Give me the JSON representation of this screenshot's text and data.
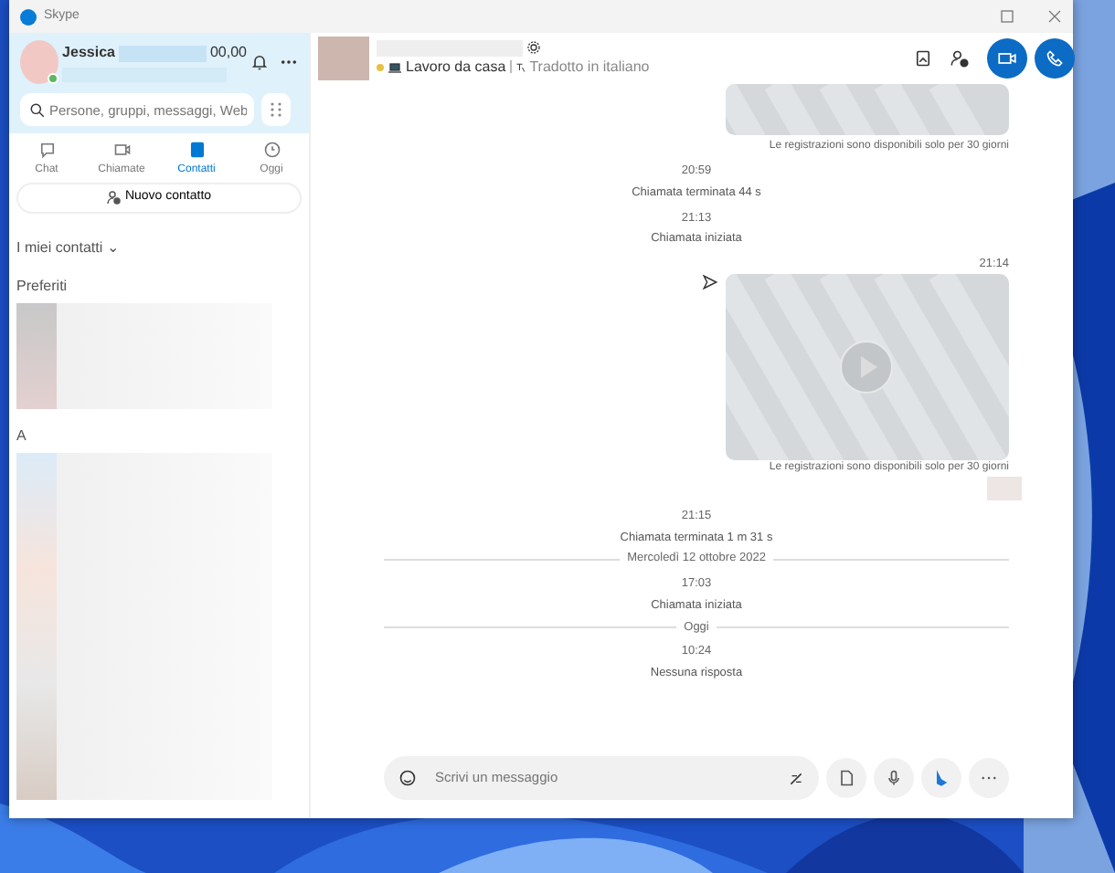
{
  "window": {
    "title": "Skype"
  },
  "profile": {
    "name": "Jessica",
    "credit": "00,00"
  },
  "search": {
    "placeholder": "Persone, gruppi, messaggi, Web"
  },
  "tabs": [
    {
      "label": "Chat",
      "selected": false
    },
    {
      "label": "Chiamate",
      "selected": false
    },
    {
      "label": "Contatti",
      "selected": true
    },
    {
      "label": "Oggi",
      "selected": false
    }
  ],
  "new_contact": "Nuovo contatto",
  "contacts_filter": "I miei contatti ⌄",
  "sections": [
    {
      "title": "Preferiti"
    },
    {
      "title": "A"
    }
  ],
  "chat": {
    "status": "Lavoro da casa",
    "translator": "Tradotto in italiano",
    "messages": [
      {
        "kind": "video_top",
        "caption": "Le registrazioni sono disponibili solo per 30 giorni"
      },
      {
        "kind": "event",
        "time": "20:59",
        "text": "Chiamata terminata 44 s"
      },
      {
        "kind": "event",
        "time": "21:13",
        "text": "Chiamata iniziata"
      },
      {
        "kind": "video",
        "time": "21:14",
        "caption": "Le registrazioni sono disponibili solo per 30 giorni"
      },
      {
        "kind": "event",
        "time": "21:15",
        "text": "Chiamata terminata 1 m 31 s"
      },
      {
        "kind": "divider",
        "text": "Mercoledì 12 ottobre 2022"
      },
      {
        "kind": "event",
        "time": "17:03",
        "text": "Chiamata iniziata"
      },
      {
        "kind": "divider",
        "text": "Oggi"
      },
      {
        "kind": "event",
        "time": "10:24",
        "text": "Nessuna risposta"
      }
    ],
    "composer_placeholder": "Scrivi un messaggio"
  }
}
